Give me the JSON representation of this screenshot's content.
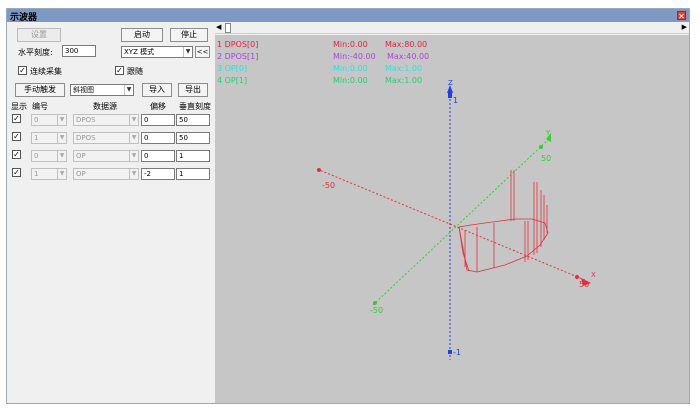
{
  "window": {
    "title": "示波器"
  },
  "toolbar": {
    "disabled_button": "设置",
    "start_button": "启动",
    "stop_button": "停止",
    "collapse_button": "<<"
  },
  "settings": {
    "h_scale_label": "水平刻度:",
    "h_scale_value": "300",
    "mode_value": "XYZ 模式",
    "continuous_label": "连续采集",
    "follow_label": "跟随",
    "manual_trigger_button": "手动触发",
    "view_value": "斜视图",
    "import_button": "导入",
    "export_button": "导出"
  },
  "table": {
    "headers": [
      "显示",
      "编号",
      "数据源",
      "偏移",
      "垂直刻度"
    ],
    "rows": [
      {
        "id": "0",
        "source": "DPOS",
        "offset": "0",
        "scale": "50"
      },
      {
        "id": "1",
        "source": "DPOS",
        "offset": "0",
        "scale": "50"
      },
      {
        "id": "0",
        "source": "OP",
        "offset": "0",
        "scale": "1"
      },
      {
        "id": "1",
        "source": "OP",
        "offset": "-2",
        "scale": "1"
      }
    ]
  },
  "legend": [
    {
      "name": "1 DPOS[0]",
      "min": "Min:0.00",
      "max": "Max:80.00",
      "color": "#e8203c"
    },
    {
      "name": "2 DPOS[1]",
      "min": "Min:-40.00",
      "max": "Max:40.00",
      "color": "#b040e0"
    },
    {
      "name": "3 OP[0]",
      "min": "Min:0.00",
      "max": "Max:1.00",
      "color": "#1ee6e6"
    },
    {
      "name": "4 OP[1]",
      "min": "Min:0.00",
      "max": "Max:1.00",
      "color": "#20d070"
    }
  ],
  "axes": {
    "z_top": "1",
    "z_bottom": "-1",
    "x_left": "-50",
    "x_right": "50",
    "y_top": "50",
    "y_bottom": "-50",
    "x_name": "X",
    "y_name": "Y",
    "z_name": "Z"
  },
  "colors": {
    "x_axis": "#e03040",
    "y_axis": "#30d030",
    "z_axis": "#2040e0",
    "trace": "#e03040",
    "plot_bg": "#c6c6c6"
  }
}
